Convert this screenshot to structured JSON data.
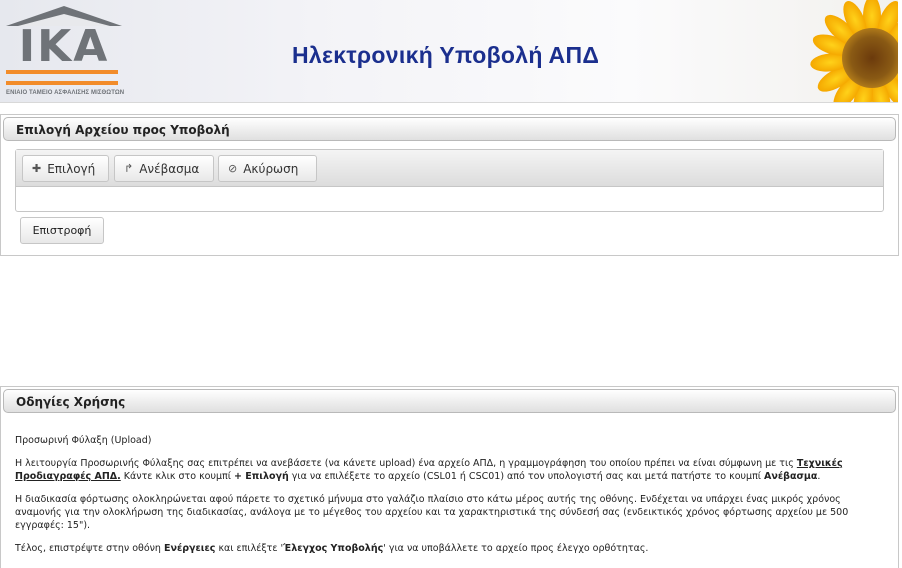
{
  "banner": {
    "logo_text": "IKA",
    "logo_caption": "ΕΝΙΑΙΟ ΤΑΜΕΙΟ ΑΣΦΑΛΙΣΗΣ ΜΙΣΘΩΤΩΝ",
    "title": "Ηλεκτρονική Υποβολή ΑΠΔ",
    "image": "sunflower"
  },
  "file_panel": {
    "header": "Επιλογή Αρχείου προς Υποβολή",
    "buttons": {
      "select": {
        "label": "Επιλογή",
        "icon": "plus-icon"
      },
      "upload": {
        "label": "Ανέβασμα",
        "icon": "upload-arrow-icon"
      },
      "cancel": {
        "label": "Ακύρωση",
        "icon": "cancel-icon"
      }
    },
    "back_label": "Επιστροφή"
  },
  "instructions_panel": {
    "header": "Οδηγίες Χρήσης",
    "p1": "Προσωρινή Φύλαξη (Upload)",
    "p2": {
      "t1": "Η λειτουργία Προσωρινής Φύλαξης σας επιτρέπει να ανεβάσετε (να κάνετε upload) ένα αρχείο ΑΠΔ, η γραμμογράφηση του οποίου πρέπει να είναι σύμφωνη με τις ",
      "link": "Τεχνικές Προδιαγραφές ΑΠΔ.",
      "t2": " Κάντε κλικ στο κουμπί ",
      "b1": "+ Επιλογή",
      "t3": " για να επιλέξετε το αρχείο (CSL01 ή CSC01) από τον υπολογιστή σας και μετά πατήστε το κουμπί ",
      "b2": "Ανέβασμα",
      "t4": "."
    },
    "p3": "Η διαδικασία φόρτωσης ολοκληρώνεται αφού πάρετε το σχετικό μήνυμα στο γαλάζιο πλαίσιο στο κάτω μέρος αυτής της οθόνης. Ενδέχεται να υπάρχει ένας μικρός χρόνος αναμονής για την ολοκλήρωση της διαδικασίας, ανάλογα με το μέγεθος του αρχείου και τα χαρακτηριστικά της σύνδεσή σας (ενδεικτικός χρόνος φόρτωσης αρχείου με 500 εγγραφές: 15\").",
    "p4": {
      "t1": "Τέλος, επιστρέψτε στην οθόνη ",
      "b1": "Ενέργειες",
      "t2": " και επιλέξτε '",
      "b2": "Έλεγχος Υποβολής",
      "t3": "' για να υποβάλλετε το αρχείο προς έλεγχο ορθότητας."
    }
  }
}
